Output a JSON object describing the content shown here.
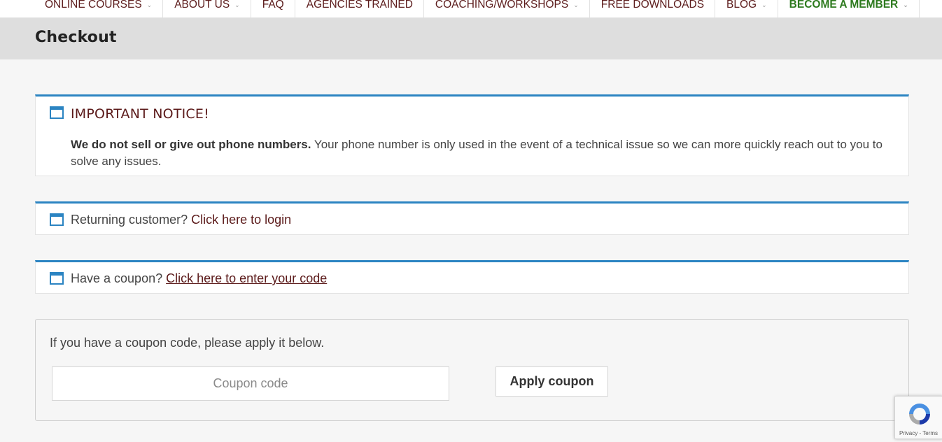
{
  "nav": {
    "items": [
      {
        "label": "ONLINE COURSES",
        "has_dropdown": true
      },
      {
        "label": "ABOUT US",
        "has_dropdown": true
      },
      {
        "label": "FAQ",
        "has_dropdown": false
      },
      {
        "label": "AGENCIES TRAINED",
        "has_dropdown": false
      },
      {
        "label": "COACHING/WORKSHOPS",
        "has_dropdown": true
      },
      {
        "label": "FREE DOWNLOADS",
        "has_dropdown": false
      },
      {
        "label": "BLOG",
        "has_dropdown": true
      },
      {
        "label": "BECOME A MEMBER",
        "has_dropdown": true
      }
    ],
    "chevron_icon": "chevron-down-icon"
  },
  "page": {
    "title": "Checkout"
  },
  "important_notice": {
    "icon": "window-icon",
    "title": "IMPORTANT NOTICE!",
    "bold_text": "We do not sell or give out phone numbers.",
    "body_text": " Your phone number is only used in the event of a technical issue so we can more quickly reach out to you to solve any issues."
  },
  "returning_customer": {
    "icon": "window-icon",
    "text": "Returning customer?",
    "link_text": "Click here to login"
  },
  "coupon_notice": {
    "icon": "window-icon",
    "text": "Have a coupon?",
    "link_text": "Click here to enter your code"
  },
  "coupon_form": {
    "instruction": "If you have a coupon code, please apply it below.",
    "input_placeholder": "Coupon code",
    "input_value": "",
    "apply_label": "Apply coupon"
  },
  "recaptcha": {
    "icon": "recaptcha-icon",
    "privacy_label": "Privacy",
    "separator": " - ",
    "terms_label": "Terms"
  },
  "colors": {
    "accent_blue": "#2b84c2",
    "link_maroon": "#5b1a1a",
    "member_green": "#2d7a1e",
    "title_band": "#dedede"
  }
}
